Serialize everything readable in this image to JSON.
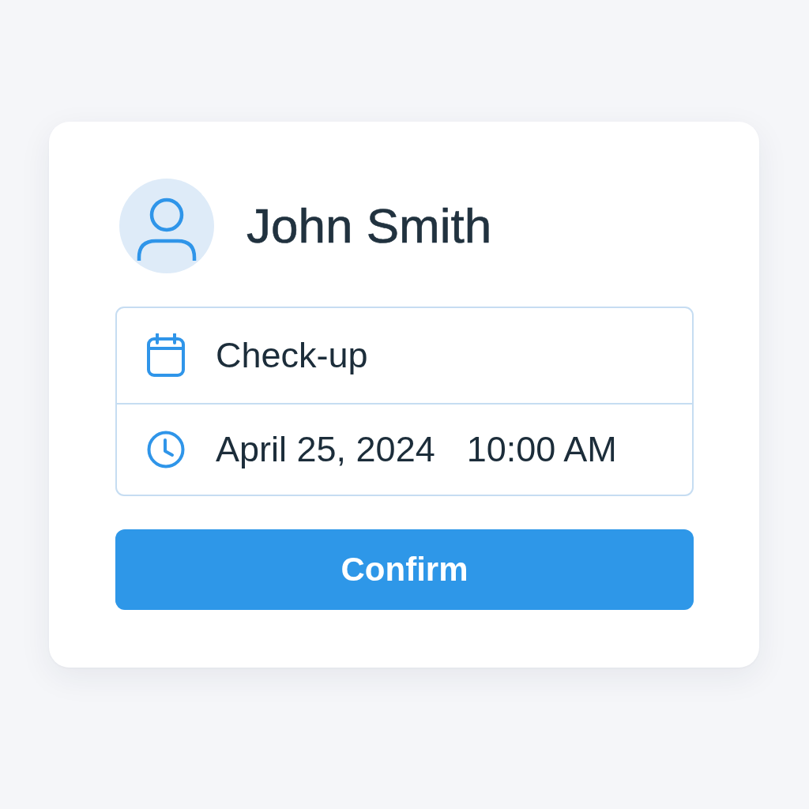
{
  "profile": {
    "name": "John Smith"
  },
  "details": [
    {
      "kind": "calendar",
      "texts": [
        "Check-up"
      ]
    },
    {
      "kind": "clock",
      "texts": [
        "April 25, 2024",
        "10:00 AM"
      ]
    }
  ],
  "confirm_button": {
    "label": "Confirm"
  }
}
